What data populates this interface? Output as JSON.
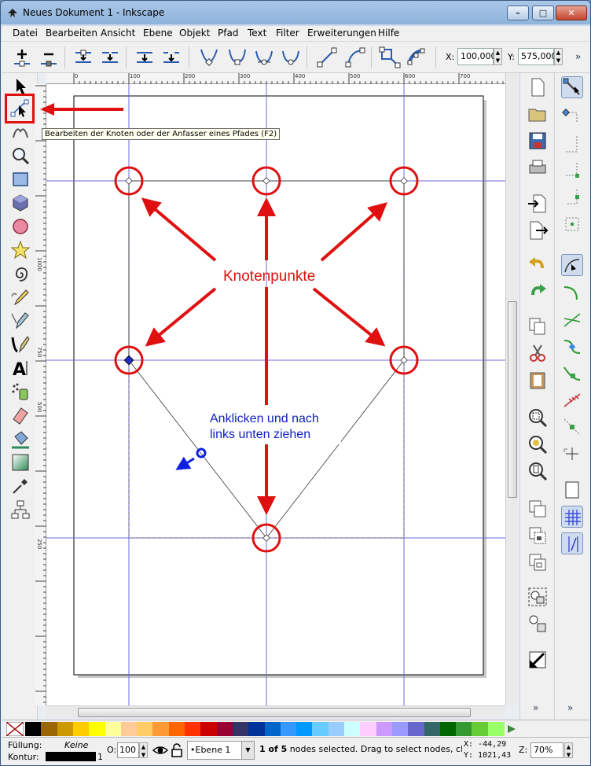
{
  "window": {
    "title": "Neues Dokument 1 - Inkscape",
    "minimize": "–",
    "maximize": "□",
    "close": "✕"
  },
  "menu": [
    "Datei",
    "Bearbeiten",
    "Ansicht",
    "Ebene",
    "Objekt",
    "Pfad",
    "Text",
    "Filter",
    "Erweiterungen",
    "Hilfe"
  ],
  "controls": {
    "icons": [
      "insert-node-icon",
      "delete-node-icon",
      "join-nodes-icon",
      "break-path-icon",
      "join-segment-icon",
      "delete-segment-icon",
      "cusp-node-icon",
      "smooth-node-icon",
      "symmetric-node-icon",
      "auto-smooth-node-icon",
      "to-line-icon",
      "to-curve-icon",
      "object-to-path-icon",
      "stroke-to-path-icon"
    ],
    "x_label": "X:",
    "x_value": "100,000",
    "y_label": "Y:",
    "y_value": "575,000",
    "more": "»"
  },
  "toolbox": {
    "tools": [
      "selector-tool-icon",
      "node-tool-icon",
      "tweak-tool-icon",
      "zoom-tool-icon",
      "rectangle-tool-icon",
      "box3d-tool-icon",
      "ellipse-tool-icon",
      "star-tool-icon",
      "spiral-tool-icon",
      "pencil-tool-icon",
      "pen-tool-icon",
      "calligraphy-tool-icon",
      "text-tool-icon",
      "spray-tool-icon",
      "eraser-tool-icon",
      "paint-bucket-tool-icon",
      "gradient-tool-icon",
      "dropper-tool-icon",
      "connector-tool-icon"
    ],
    "tooltip": "Bearbeiten der Knoten oder der Anfasser eines Pfades (F2)"
  },
  "ruler": {
    "top_labels": [
      "0",
      "100",
      "200",
      "300",
      "400",
      "500",
      "600",
      "700"
    ],
    "left_labels": [
      "1000",
      "750",
      "500",
      "250"
    ]
  },
  "annotations": {
    "nodes_label": "Knotenpunkte",
    "instruction": [
      "Anklicken und nach",
      "links unten ziehen"
    ]
  },
  "commands": {
    "icons": [
      "new-document-icon",
      "open-icon",
      "save-icon",
      "print-icon",
      "import-icon",
      "export-icon",
      "undo-icon",
      "redo-icon",
      "copy-icon",
      "cut-icon",
      "paste-icon",
      "zoom-selection-icon",
      "zoom-drawing-icon",
      "zoom-page-icon",
      "duplicate-icon",
      "clone-icon",
      "unlink-clone-icon",
      "group-icon",
      "ungroup-icon",
      "fill-stroke-icon"
    ],
    "more": "»"
  },
  "snap": {
    "icons": [
      "snap-toggle-icon",
      "snap-bbox-icon",
      "snap-bbox-edge-icon",
      "snap-bbox-corner-icon",
      "snap-bbox-midpoint-icon",
      "snap-bbox-center-icon",
      "snap-nodes-icon",
      "snap-path-icon",
      "snap-intersection-icon",
      "snap-cusp-icon",
      "snap-smooth-icon",
      "snap-line-midpoint-icon",
      "snap-object-midpoint-icon",
      "snap-rotation-center-icon",
      "snap-page-border-icon",
      "snap-grid-icon",
      "snap-guide-icon"
    ],
    "more": "»"
  },
  "palette": {
    "colors": [
      "#000000",
      "#996600",
      "#cc9900",
      "#ffcc00",
      "#ffff00",
      "#ffff99",
      "#ffcc99",
      "#ffcc66",
      "#ff9933",
      "#ff6600",
      "#ff3300",
      "#cc0000",
      "#990033",
      "#333366",
      "#003399",
      "#0066cc",
      "#3399ff",
      "#0099ff",
      "#66ccff",
      "#99ccff",
      "#ccffff",
      "#ffccff",
      "#cc99ff",
      "#9999ff",
      "#6666cc",
      "#336666",
      "#006600",
      "#339933",
      "#66cc33",
      "#99ff66"
    ]
  },
  "status": {
    "fill_label": "Füllung:",
    "fill_value": "Keine",
    "stroke_label": "Kontur:",
    "stroke_width": "1",
    "opacity_label": "O:",
    "opacity_value": "100",
    "layer": "•Ebene 1",
    "message_bold": "1 of 5",
    "message": " nodes selected. Drag to select nodes, click",
    "x_coord": "X:   -44,29",
    "y_coord": "Y: 1021,43",
    "zoom_label": "Z:",
    "zoom_value": "70%"
  }
}
